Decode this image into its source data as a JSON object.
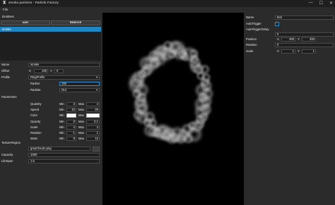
{
  "window": {
    "title": "smoke.particles - Particle Factory",
    "icon": "app-icon",
    "minimize": "—",
    "maximize": "☐",
    "close": "✕"
  },
  "menu": {
    "file": "File"
  },
  "emitters": {
    "header": "Emitters",
    "add_label": "ADD",
    "remove_label": "REMOVE",
    "items": [
      "smoke"
    ]
  },
  "emitter_props": {
    "name_label": "Name",
    "name_value": "smoke",
    "offset_label": "Offset",
    "offset_x_label": "X",
    "offset_x": "100",
    "offset_y_label": "Y",
    "offset_y": "0",
    "profile_label": "Profile",
    "profile_value": "RingProfile",
    "radius_label": "Radius",
    "radius_value": "150",
    "radiate_label": "Radiate",
    "radiate_value": "Out"
  },
  "parameters": {
    "header": "Parameters",
    "min_label": "Min",
    "max_label": "Max",
    "rows": [
      {
        "name": "Quantity",
        "min": "2",
        "max": "4"
      },
      {
        "name": "Speed",
        "min": "10",
        "max": "20"
      },
      {
        "name": "Color",
        "min": "",
        "max": ""
      },
      {
        "name": "Opacity",
        "min": "0",
        "max": "0.1"
      },
      {
        "name": "Scale",
        "min": "4",
        "max": "4"
      },
      {
        "name": "Rotation",
        "min": "-1",
        "max": "1"
      },
      {
        "name": "Mass",
        "min": "8",
        "max": "12"
      }
    ]
  },
  "texture": {
    "label": "TextureRegion",
    "value": "greyCloud1.png",
    "browse": "..."
  },
  "capacity": {
    "label": "Capacity",
    "value": "1000"
  },
  "lifespan": {
    "label": "LifeSpan",
    "value": "1.5"
  },
  "modifier": {
    "name_label": "Name",
    "name_value": "test",
    "autotrigger_label": "AutoTrigger",
    "autotrigger_checked": true,
    "autotrigger_delay_label": "AutoTriggerDelay",
    "autotrigger_delay_value": "0",
    "position_label": "Position",
    "position_x_label": "X",
    "position_x": "400",
    "position_y_label": "Y",
    "position_y": "400",
    "rotation_label": "Rotation",
    "rotation_value": "0",
    "scale_label": "Scale",
    "scale_x_label": "X",
    "scale_x": "1",
    "scale_y_label": "Y",
    "scale_y": "1"
  },
  "colors": {
    "accent": "#1e86c3",
    "panel": "#2b2b2b",
    "field": "#1e1e1e",
    "canvas": "#000000"
  }
}
